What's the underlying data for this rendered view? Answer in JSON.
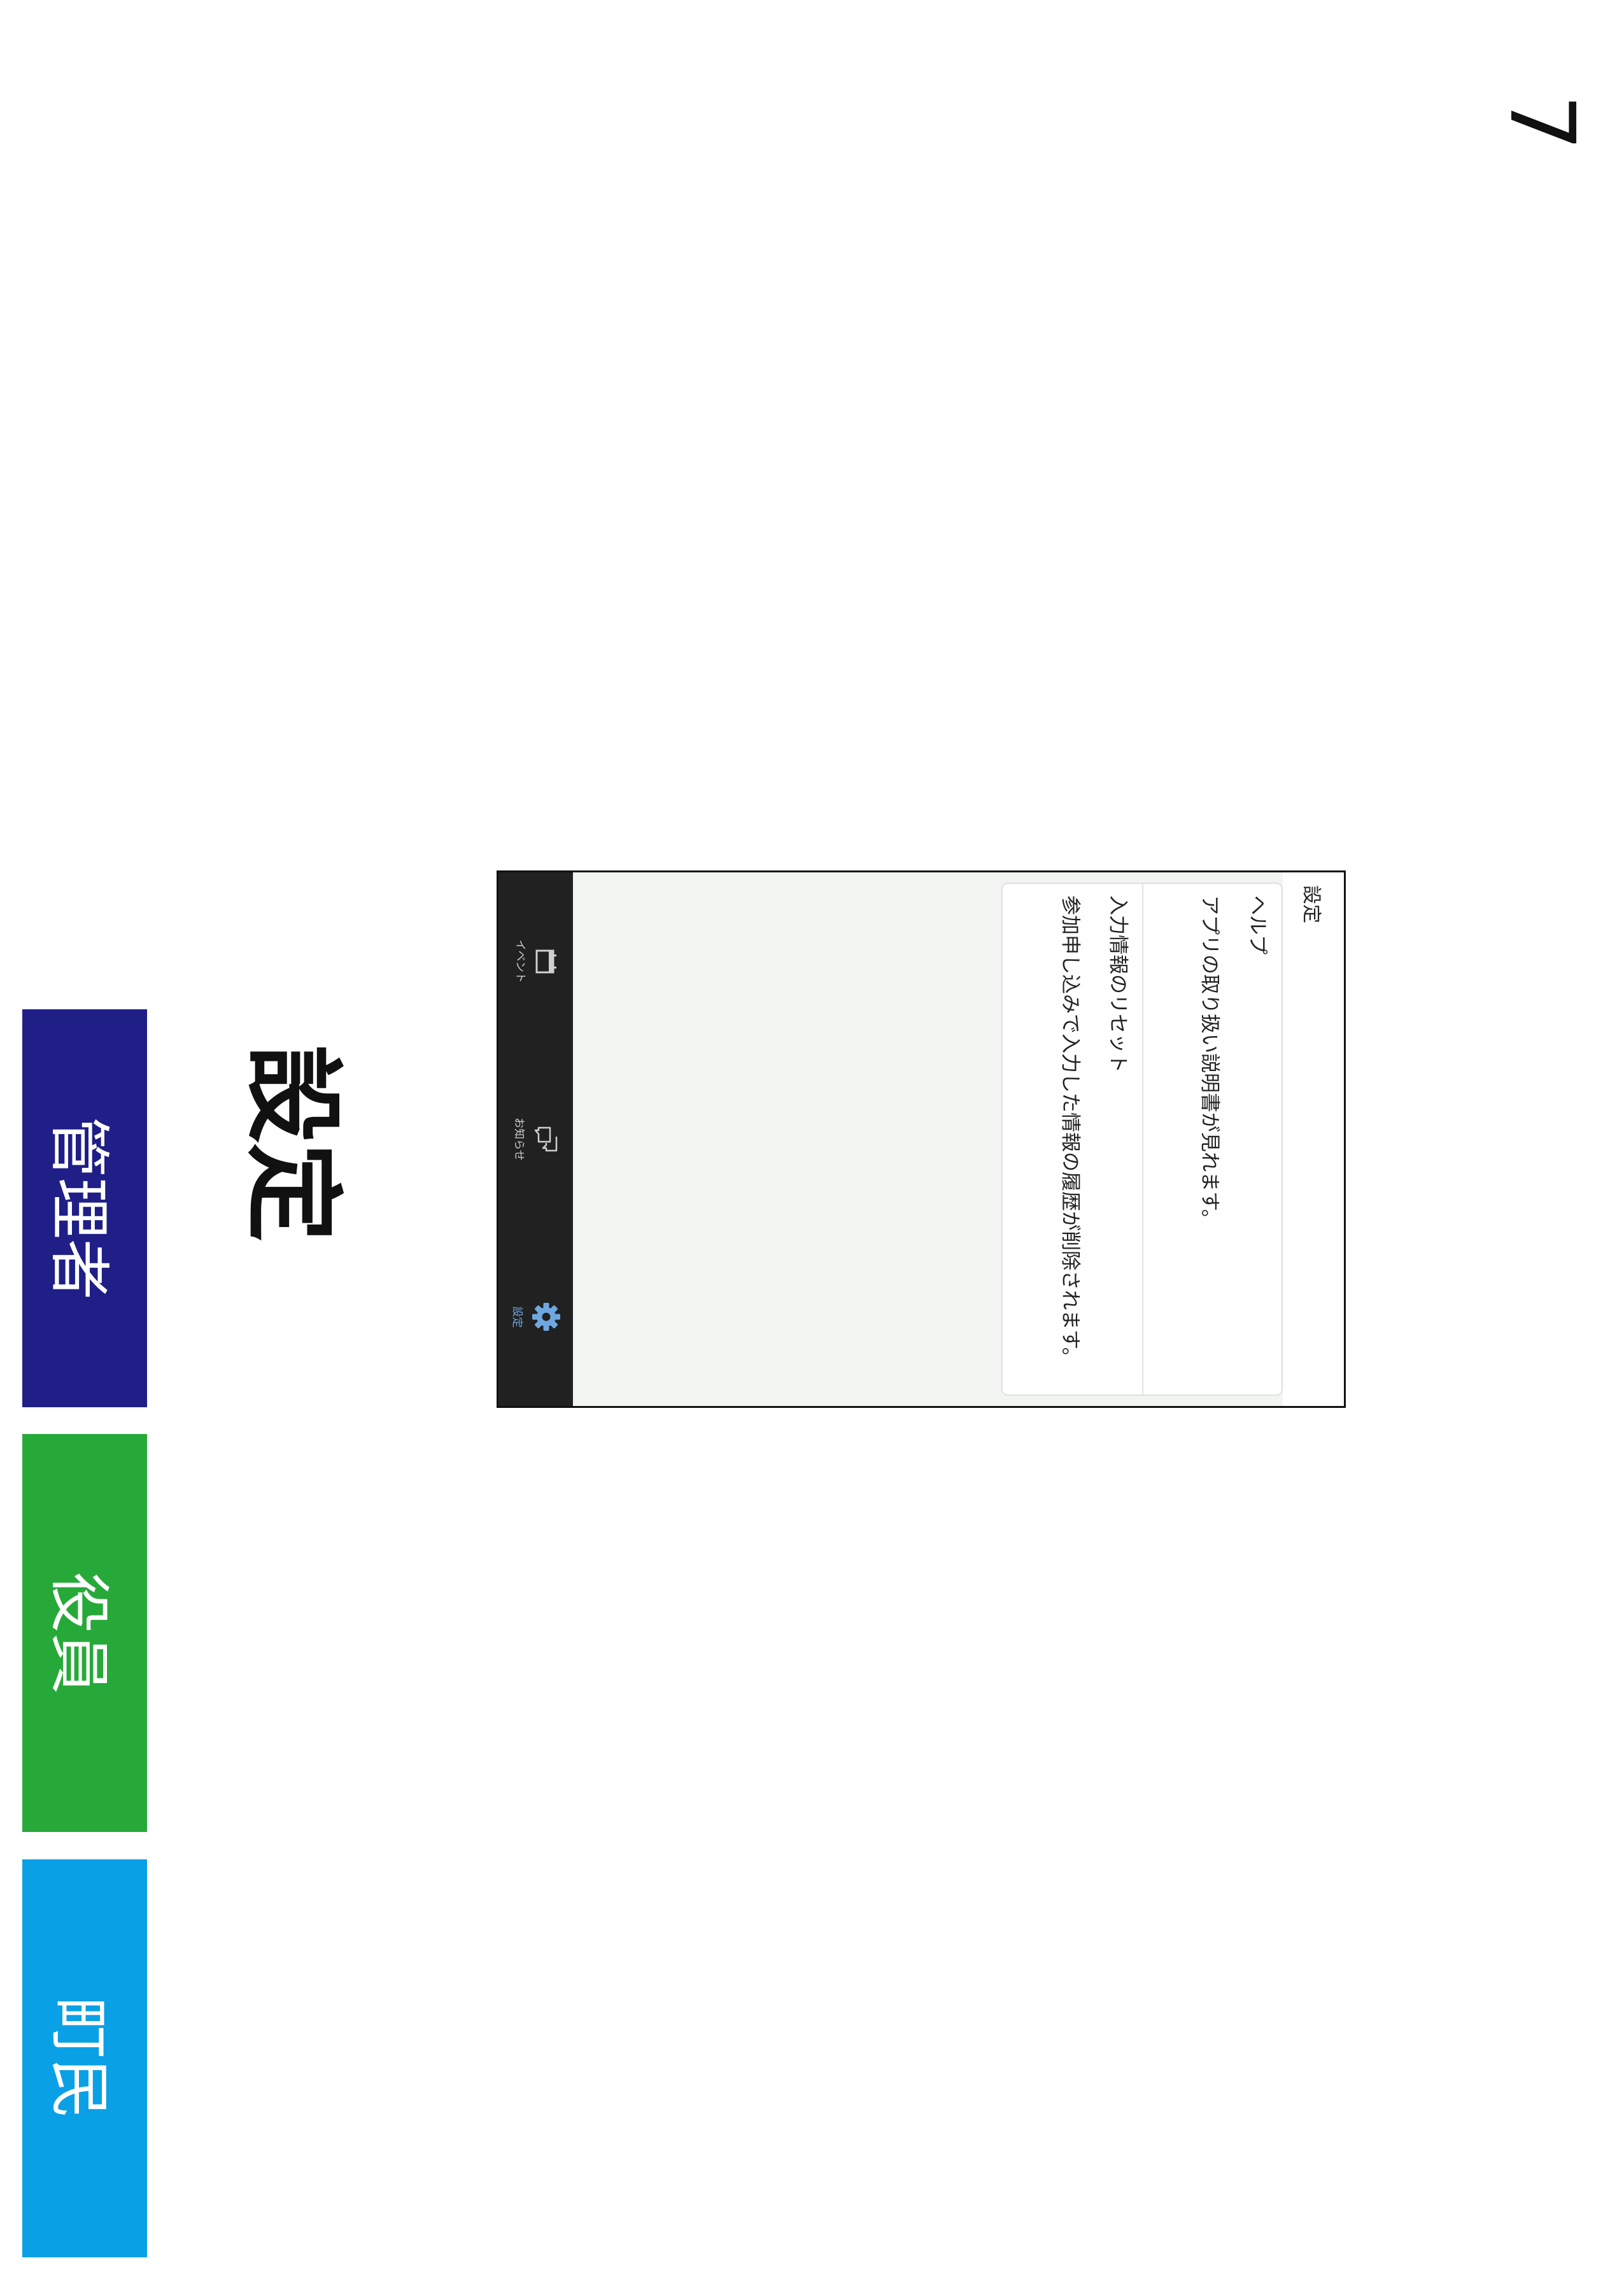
{
  "page_number": "7",
  "section_title": "設定",
  "role_tabs": {
    "admin": "管理者",
    "officer": "役員",
    "resident": "町民"
  },
  "colors": {
    "admin": "#1f1f87",
    "officer": "#27a93a",
    "resident": "#0aa0e6",
    "tab_bar": "#212121",
    "active_tab": "#6fa8e0"
  },
  "phone": {
    "header_title": "設定",
    "items": [
      {
        "title": "ヘルプ",
        "description": "アプリの取り扱い説明書が見れます。"
      },
      {
        "title": "入力情報のリセット",
        "description": "参加申し込みで入力した情報の履歴が削除されます。"
      }
    ],
    "tabs": [
      {
        "label": "イベント",
        "icon": "calendar-icon",
        "active": false
      },
      {
        "label": "お知らせ",
        "icon": "chat-bubbles-icon",
        "active": false
      },
      {
        "label": "設定",
        "icon": "gear-icon",
        "active": true
      }
    ]
  }
}
